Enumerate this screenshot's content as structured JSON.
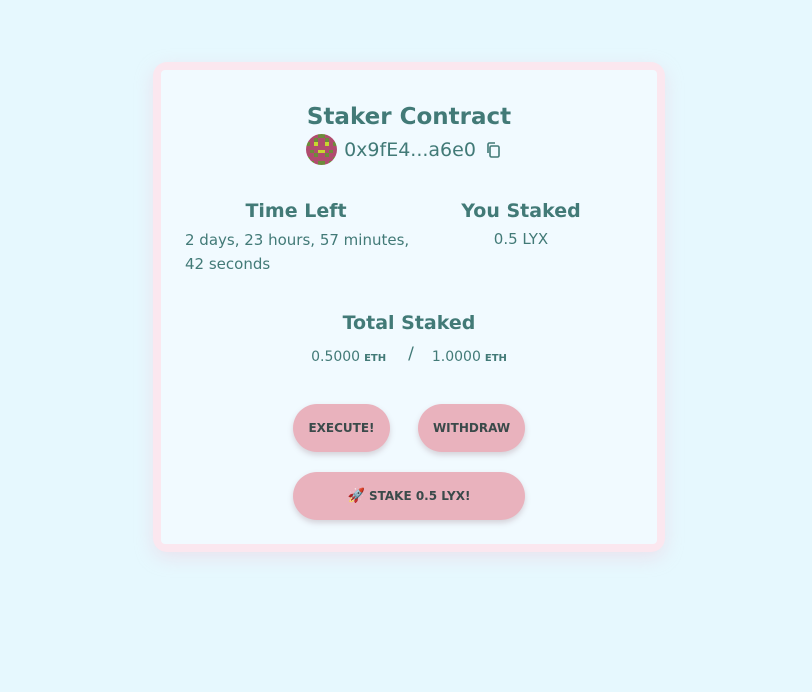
{
  "card": {
    "title": "Staker Contract",
    "address": "0x9fE4...a6e0",
    "copy_icon": "copy-icon"
  },
  "time_left": {
    "heading": "Time Left",
    "value": "2 days, 23 hours, 57 minutes, 42 seconds"
  },
  "you_staked": {
    "heading": "You Staked",
    "value": "0.5 LYX"
  },
  "total_staked": {
    "heading": "Total Staked",
    "current": "0.5000",
    "current_unit": "ETH",
    "separator": "/",
    "threshold": "1.0000",
    "threshold_unit": "ETH"
  },
  "buttons": {
    "execute": "EXECUTE!",
    "withdraw": "WITHDRAW",
    "stake_icon": "🚀",
    "stake": "STAKE 0.5 LYX!"
  },
  "colors": {
    "background": "#e6f8fe",
    "card": "#f1faff",
    "card_border": "#fbe7ef",
    "text": "#427a77",
    "button": "#e9b2bd"
  }
}
